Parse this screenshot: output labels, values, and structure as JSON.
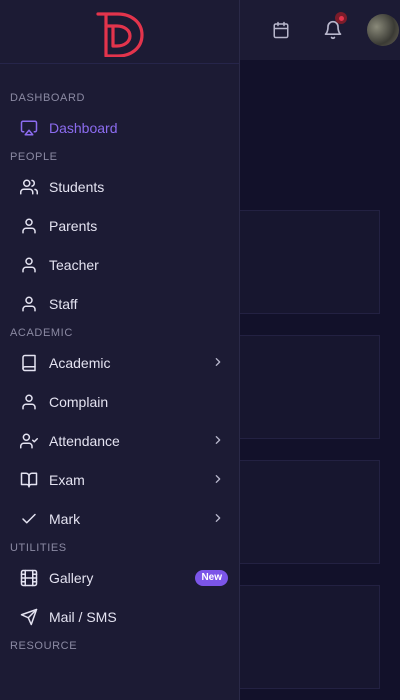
{
  "sidebar": {
    "sections": [
      {
        "title": "DASHBOARD",
        "items": [
          {
            "label": "Dashboard",
            "icon": "monitor-icon",
            "active": true
          }
        ]
      },
      {
        "title": "PEOPLE",
        "items": [
          {
            "label": "Students",
            "icon": "users-icon"
          },
          {
            "label": "Parents",
            "icon": "user-icon"
          },
          {
            "label": "Teacher",
            "icon": "user-icon"
          },
          {
            "label": "Staff",
            "icon": "user-icon"
          }
        ]
      },
      {
        "title": "ACADEMIC",
        "items": [
          {
            "label": "Academic",
            "icon": "book-icon",
            "chevron": true
          },
          {
            "label": "Complain",
            "icon": "user-icon"
          },
          {
            "label": "Attendance",
            "icon": "user-check-icon",
            "chevron": true
          },
          {
            "label": "Exam",
            "icon": "book-open-icon",
            "chevron": true
          },
          {
            "label": "Mark",
            "icon": "check-icon",
            "chevron": true
          }
        ]
      },
      {
        "title": "UTILITIES",
        "items": [
          {
            "label": "Gallery",
            "icon": "film-icon",
            "badge": "New"
          },
          {
            "label": "Mail / SMS",
            "icon": "send-icon"
          }
        ]
      },
      {
        "title": "RESOURCE",
        "items": []
      }
    ]
  },
  "topbar": {
    "icons": [
      "calendar-icon",
      "bell-icon",
      "avatar"
    ]
  },
  "colors": {
    "accent": "#8c6cf0",
    "brand": "#e3344c",
    "sidebar_bg": "#1c1b34",
    "badge_bg": "#7b55e8"
  }
}
